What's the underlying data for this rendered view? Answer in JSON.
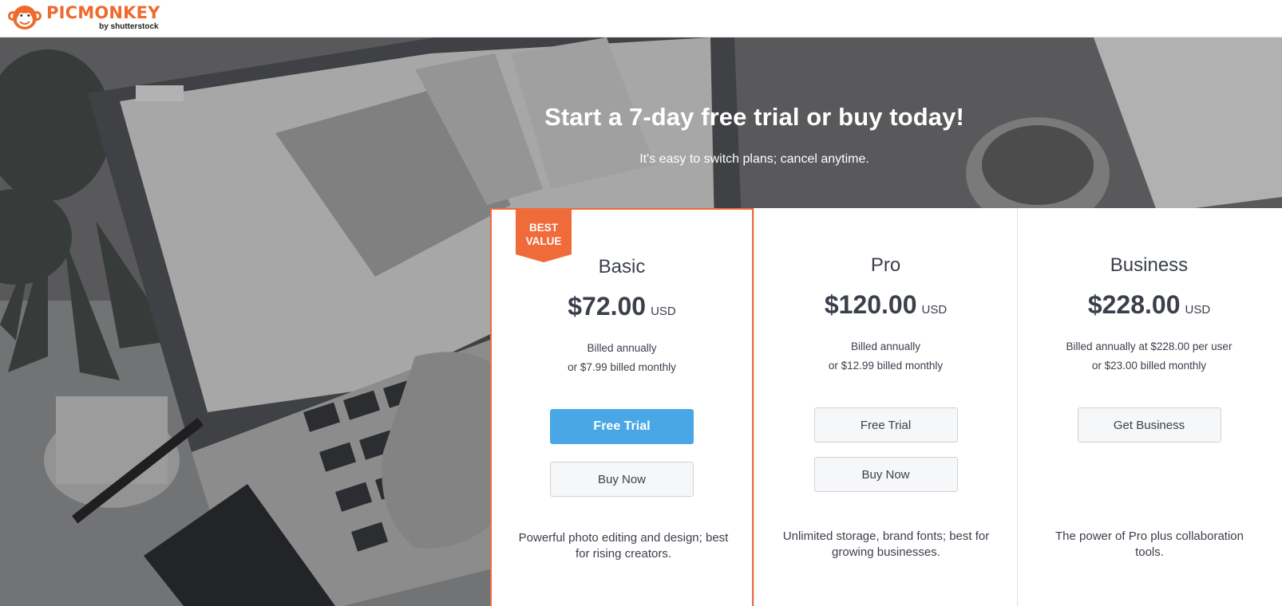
{
  "brand": {
    "name": "PICMONKEY",
    "byline": "by shutterstock",
    "color": "#ee6a2e"
  },
  "hero": {
    "title": "Start a 7-day free trial or buy today!",
    "subtitle": "It's easy to switch plans; cancel anytime."
  },
  "plans": [
    {
      "name": "Basic",
      "price": "$72.00",
      "currency": "USD",
      "billing_line1": "Billed annually",
      "billing_line2": "or $7.99 billed monthly",
      "primary_button": "Free Trial",
      "secondary_button": "Buy Now",
      "description": "Powerful photo editing and design; best for rising creators.",
      "badge": "BEST VALUE",
      "featured": true
    },
    {
      "name": "Pro",
      "price": "$120.00",
      "currency": "USD",
      "billing_line1": "Billed annually",
      "billing_line2": "or $12.99 billed monthly",
      "primary_button": "Free Trial",
      "secondary_button": "Buy Now",
      "description": "Unlimited storage, brand fonts; best for growing businesses."
    },
    {
      "name": "Business",
      "price": "$228.00",
      "currency": "USD",
      "billing_line1": "Billed annually at $228.00 per user",
      "billing_line2": "or $23.00 billed monthly",
      "primary_button": "Get Business",
      "description": "The power of Pro plus collaboration tools."
    }
  ],
  "colors": {
    "accent_orange": "#ef6b3a",
    "primary_blue": "#49a7e6",
    "text": "#3a3f4a"
  }
}
